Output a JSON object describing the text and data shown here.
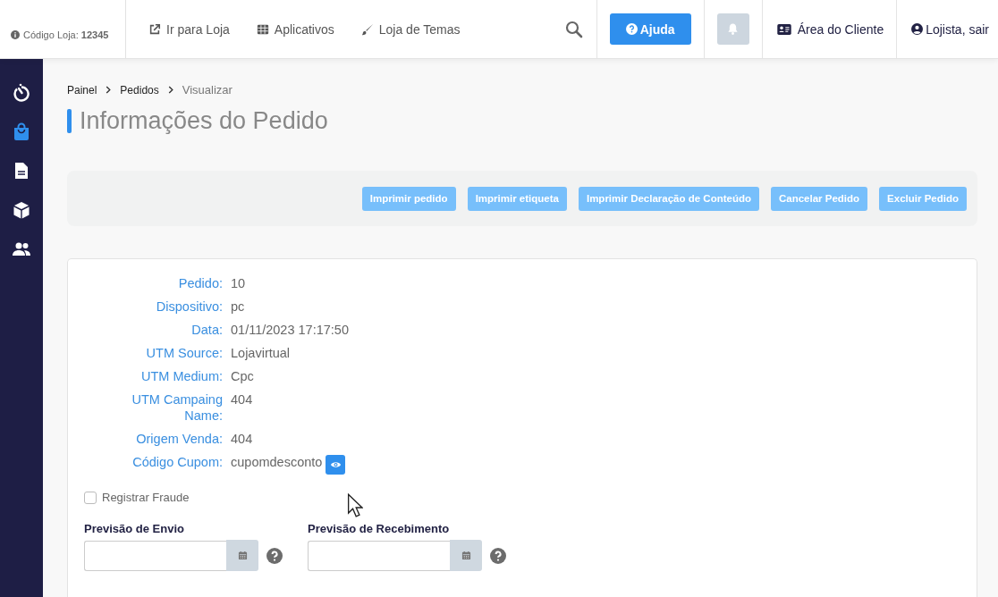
{
  "topbar": {
    "store_code": "Código Loja: **12345**",
    "links": [
      {
        "label": "Ir para Loja"
      },
      {
        "label": "Aplicativos"
      },
      {
        "label": "Loja de Temas"
      }
    ],
    "help_button": "Ajuda",
    "client_area": "Área do Cliente",
    "user": "Lojista, sair"
  },
  "sidebar": {
    "items": [
      {
        "selected": false
      },
      {
        "selected": true
      },
      {
        "selected": false
      },
      {
        "selected": false
      },
      {
        "selected": false
      }
    ]
  },
  "breadcrumb": [
    {
      "label": "Painel",
      "current": false
    },
    {
      "label": "Pedidos",
      "current": false
    },
    {
      "label": "Visualizar",
      "current": true
    }
  ],
  "title": "Informações do Pedido",
  "actions": [
    "Imprimir pedido",
    "Imprimir etiqueta",
    "Imprimir Declaração de Conteúdo",
    "Cancelar Pedido",
    "Excluir Pedido"
  ],
  "details": [
    {
      "label": "Pedido:",
      "value": "10"
    },
    {
      "label": "Dispositivo:",
      "value": "pc"
    },
    {
      "label": "Data:",
      "value": "01/11/2023 17:17:50"
    },
    {
      "label": "UTM Source:",
      "value": "Lojavirtual"
    },
    {
      "label": "UTM Medium:",
      "value": "Cpc"
    },
    {
      "label": "UTM Campaing Name:",
      "value": "404"
    },
    {
      "label": "Origem Venda:",
      "value": "404"
    },
    {
      "label": "Código Cupom:",
      "value": "cupomdesconto",
      "reveal": true
    }
  ],
  "fraud": {
    "label": "Registrar Fraude",
    "checked": false
  },
  "dates": [
    {
      "label": "Previsão de Envio"
    },
    {
      "label": "Previsão de Recebimento"
    }
  ]
}
